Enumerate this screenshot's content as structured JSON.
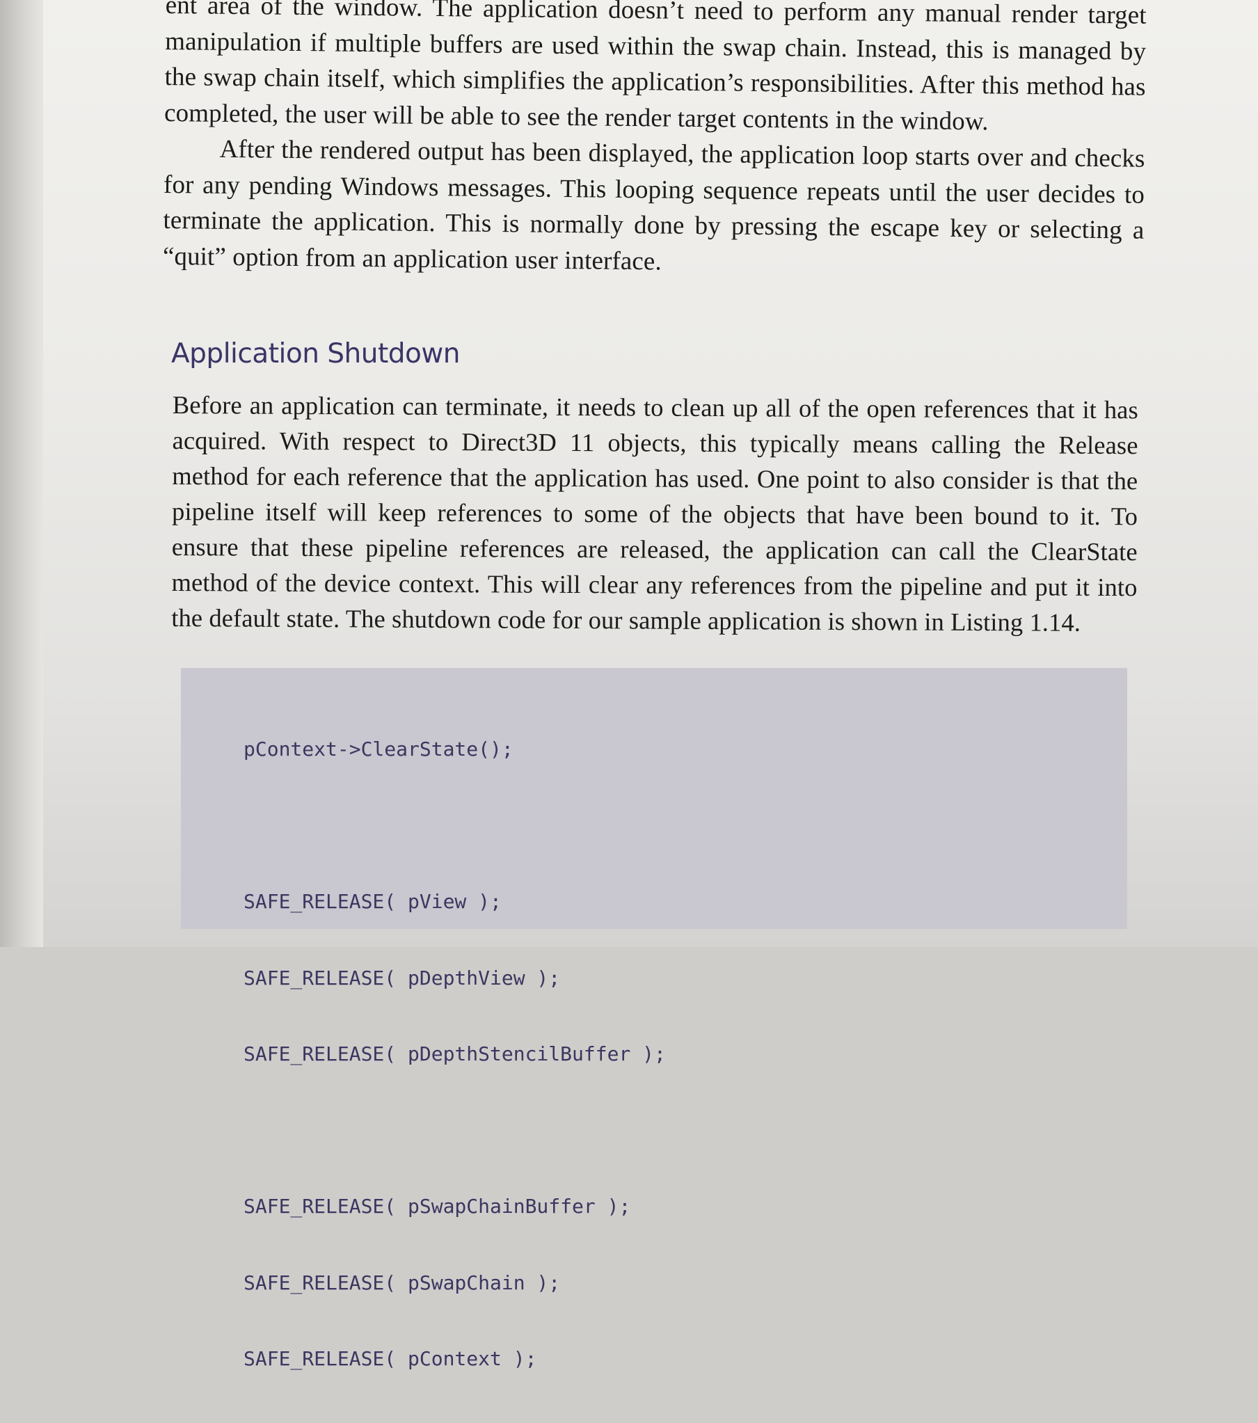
{
  "body_top": {
    "paragraph_1": "ent area of the window. The application doesn’t need to perform any manual render target manipulation if multiple buffers are used within the swap chain. Instead, this is managed by the swap chain itself, which simplifies the application’s responsibilities. After this method has completed, the user will be able to see the render target contents in the window.",
    "paragraph_2": "After the rendered output has been displayed, the application loop starts over and checks for any pending Windows messages. This looping sequence repeats until the user decides to terminate the application. This is normally done by pressing the escape key or selecting a “quit” option from an application user interface."
  },
  "section": {
    "heading": "Application Shutdown",
    "paragraph": "Before an application can terminate, it needs to clean up all of the open references that it has acquired. With respect to Direct3D 11 objects, this typically means calling the Release method for each reference that the application has used. One point to also consider is that the pipeline itself will keep references to some of the objects that have been bound to it. To ensure that these pipeline references are released, the application can call the ClearState method of the device context. This will clear any references from the pipeline and put it into the default state. The shutdown code for our sample application is shown in Listing 1.14."
  },
  "code_listing": {
    "line_1": "pContext->ClearState();",
    "line_2": "SAFE_RELEASE( pView );",
    "line_3": "SAFE_RELEASE( pDepthView );",
    "line_4": "SAFE_RELEASE( pDepthStencilBuffer );",
    "line_5": "SAFE_RELEASE( pSwapChainBuffer );",
    "line_6": "SAFE_RELEASE( pSwapChain );",
    "line_7": "SAFE_RELEASE( pContext );"
  }
}
